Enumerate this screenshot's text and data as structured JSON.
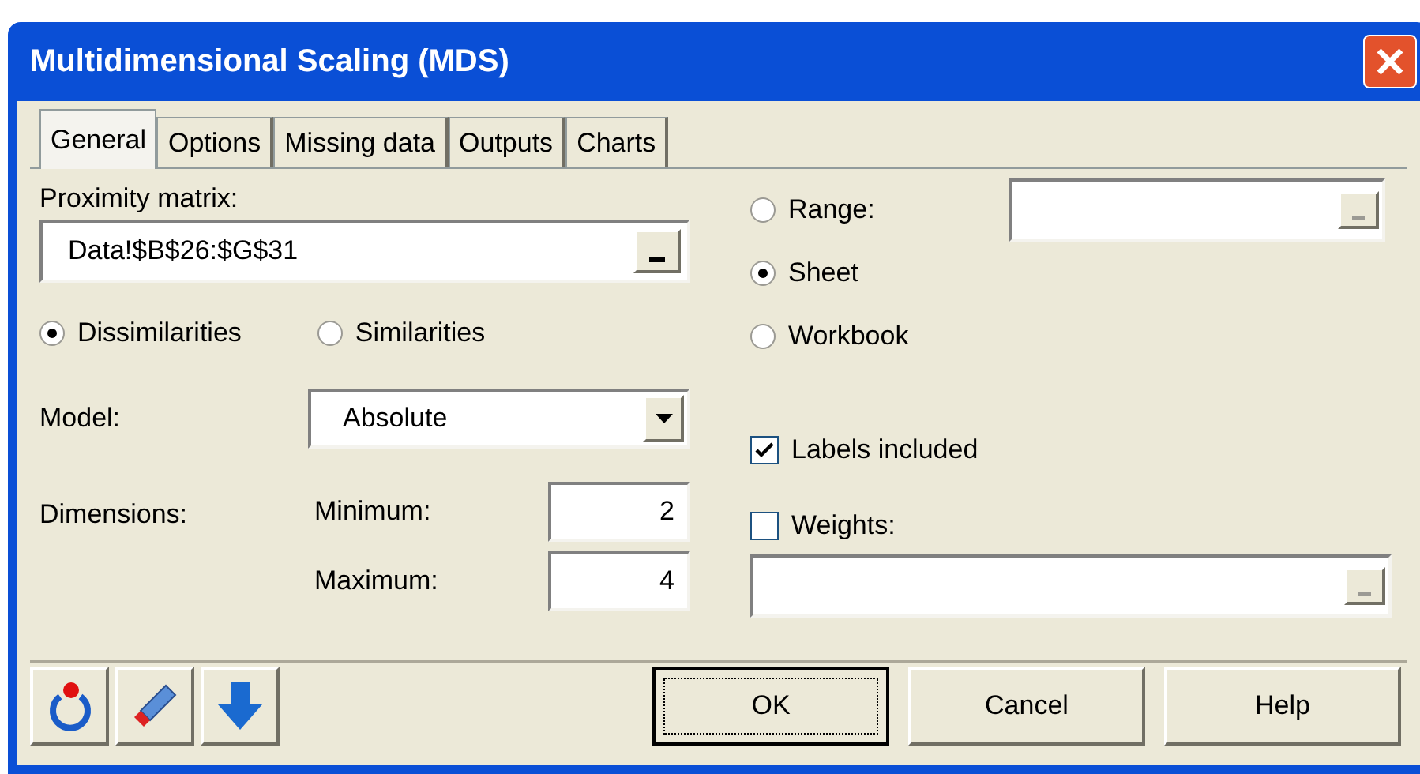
{
  "window": {
    "title": "Multidimensional Scaling (MDS)"
  },
  "tabs": [
    {
      "label": "General",
      "selected": true
    },
    {
      "label": "Options",
      "selected": false
    },
    {
      "label": "Missing data",
      "selected": false
    },
    {
      "label": "Outputs",
      "selected": false
    },
    {
      "label": "Charts",
      "selected": false
    }
  ],
  "proximity_matrix": {
    "label": "Proximity matrix:",
    "value": "Data!$B$26:$G$31"
  },
  "matrix_type": [
    {
      "label": "Dissimilarities",
      "selected": true
    },
    {
      "label": "Similarities",
      "selected": false
    }
  ],
  "model": {
    "label": "Model:",
    "value": "Absolute"
  },
  "dimensions": {
    "label": "Dimensions:",
    "fields": [
      {
        "label": "Minimum:",
        "value": "2"
      },
      {
        "label": "Maximum:",
        "value": "4"
      }
    ]
  },
  "source": [
    {
      "label": "Range:",
      "selected": false
    },
    {
      "label": "Sheet",
      "selected": true
    },
    {
      "label": "Workbook",
      "selected": false
    }
  ],
  "labels_included": {
    "label": "Labels included",
    "checked": true
  },
  "weights": {
    "label": "Weights:",
    "checked": false
  },
  "buttons": [
    "OK",
    "Cancel",
    "Help"
  ]
}
